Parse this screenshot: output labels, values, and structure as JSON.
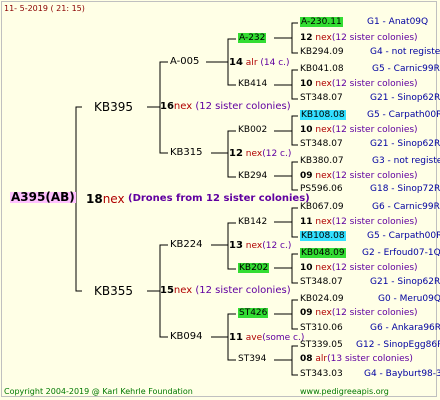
{
  "header": {
    "date": "11- 5-2019 ( 21: 15)"
  },
  "footer": {
    "copyright": "Copyright 2004-2019 @ Karl Kehrle Foundation",
    "website": "www.pedigreeapis.org"
  },
  "root": {
    "id": "A395(AB)",
    "gen": "18",
    "gen_tag": "nex",
    "note": "(Drones from 12 sister colonies)"
  },
  "sire": {
    "id": "KB395",
    "gen": "16",
    "gen_tag": "nex",
    "note": "(12 sister colonies)",
    "sire": {
      "id": "A-005",
      "gen": "14",
      "gen_tag": "alr",
      "note": "(14 c.)",
      "sire": {
        "id": "A-232",
        "gen": "12",
        "gen_tag": "nex",
        "note": "(12 sister colonies)",
        "sire": {
          "id": "A-230.11",
          "info": "G1 - Anat09Q"
        },
        "dam": {
          "id": "KB294.09",
          "info": "G4 - not registe"
        }
      },
      "dam": {
        "id": "KB414",
        "gen": "10",
        "gen_tag": "nex",
        "note": "(12 sister colonies)",
        "sire": {
          "id": "KB041.08",
          "info": "G5 - Carnic99R"
        },
        "dam": {
          "id": "ST348.07",
          "info": "G21 - Sinop62R"
        }
      }
    },
    "dam": {
      "id": "KB315",
      "gen": "12",
      "gen_tag": "nex",
      "note": "(12 c.)",
      "sire": {
        "id": "KB002",
        "gen": "10",
        "gen_tag": "nex",
        "note": "(12 sister colonies)",
        "sire": {
          "id": "KB108.08",
          "info": "G5 - Carpath00R"
        },
        "dam": {
          "id": "ST348.07",
          "info": "G21 - Sinop62R"
        }
      },
      "dam": {
        "id": "KB294",
        "gen": "09",
        "gen_tag": "nex",
        "note": "(12 sister colonies)",
        "sire": {
          "id": "KB380.07",
          "info": "G3 - not registe"
        },
        "dam": {
          "id": "PS596.06",
          "info": "G18 - Sinop72R"
        }
      }
    }
  },
  "dam": {
    "id": "KB355",
    "gen": "15",
    "gen_tag": "nex",
    "note": "(12 sister colonies)",
    "sire": {
      "id": "KB224",
      "gen": "13",
      "gen_tag": "nex",
      "note": "(12 c.)",
      "sire": {
        "id": "KB142",
        "gen": "11",
        "gen_tag": "nex",
        "note": "(12 sister colonies)",
        "sire": {
          "id": "KB067.09",
          "info": "G6 - Carnic99R"
        },
        "dam": {
          "id": "KB108.08",
          "info": "G5 - Carpath00R"
        }
      },
      "dam": {
        "id": "KB202",
        "gen": "10",
        "gen_tag": "nex",
        "note": "(12 sister colonies)",
        "sire": {
          "id": "KB048.09",
          "info": "G2 - Erfoud07-1Q"
        },
        "dam": {
          "id": "ST348.07",
          "info": "G21 - Sinop62R"
        }
      }
    },
    "dam": {
      "id": "KB094",
      "gen": "11",
      "gen_tag": "ave",
      "note": "(some c.)",
      "sire": {
        "id": "ST426",
        "gen": "09",
        "gen_tag": "nex",
        "note": "(12 sister colonies)",
        "sire": {
          "id": "KB024.09",
          "info": "G0 - Meru09Q"
        },
        "dam": {
          "id": "ST310.06",
          "info": "G6 - Ankara96R"
        }
      },
      "dam": {
        "id": "ST394",
        "gen": "08",
        "gen_tag": "alr",
        "note": "(13 sister colonies)",
        "sire": {
          "id": "ST339.05",
          "info": "G12 - SinopEgg86R"
        },
        "dam": {
          "id": "ST343.03",
          "info": "G4 - Bayburt98-3"
        }
      }
    }
  }
}
